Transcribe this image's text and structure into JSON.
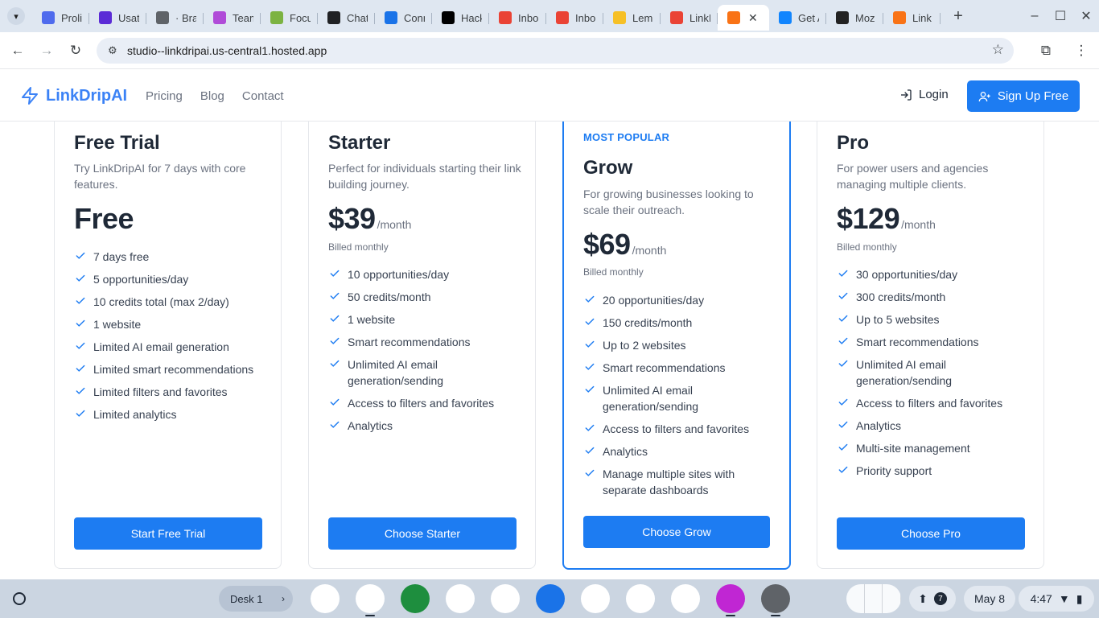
{
  "browser": {
    "tabs": [
      {
        "title": "Proli",
        "icon": "feather-icon",
        "color": "#4f6bed"
      },
      {
        "title": "Usat",
        "icon": "list-icon",
        "color": "#5b2bd6"
      },
      {
        "title": "· Bra",
        "icon": "globe-icon",
        "color": "#5f6368"
      },
      {
        "title": "Team",
        "icon": "magnifier-icon",
        "color": "#b04bd8"
      },
      {
        "title": "Focu",
        "icon": "doc-icon",
        "color": "#7cb342"
      },
      {
        "title": "Chat",
        "icon": "atom-icon",
        "color": "#202124"
      },
      {
        "title": "Conn",
        "icon": "link-icon",
        "color": "#1a73e8"
      },
      {
        "title": "Hack",
        "icon": "b-icon",
        "color": "#000000"
      },
      {
        "title": "Inbo",
        "icon": "gmail-icon",
        "color": "#ea4335"
      },
      {
        "title": "Inbo",
        "icon": "gmail-icon",
        "color": "#ea4335"
      },
      {
        "title": "Lem",
        "icon": "lemon-icon",
        "color": "#f6c026"
      },
      {
        "title": "LinkI",
        "icon": "bolt-icon",
        "color": "#ea4335"
      },
      {
        "title": "",
        "icon": "linkdrip-icon",
        "color": "#f97316",
        "active": true
      },
      {
        "title": "Get A",
        "icon": "butterfly-icon",
        "color": "#1185fe"
      },
      {
        "title": "Moz",
        "icon": "m-icon",
        "color": "#222222"
      },
      {
        "title": "Link",
        "icon": "nodes-icon",
        "color": "#f97316"
      }
    ],
    "url": "studio--linkdripai.us-central1.hosted.app"
  },
  "site": {
    "brand": "LinkDripAI",
    "nav": [
      "Pricing",
      "Blog",
      "Contact"
    ],
    "login": "Login",
    "signup": "Sign Up Free"
  },
  "plans": [
    {
      "name": "Free Trial",
      "description": "Try LinkDripAI for 7 days with core features.",
      "price": "Free",
      "period": "",
      "billing": "",
      "features": [
        "7 days free",
        "5 opportunities/day",
        "10 credits total (max 2/day)",
        "1 website",
        "Limited AI email generation",
        "Limited smart recommendations",
        "Limited filters and favorites",
        "Limited analytics"
      ],
      "cta": "Start Free Trial"
    },
    {
      "name": "Starter",
      "description": "Perfect for individuals starting their link building journey.",
      "price": "$39",
      "period": "/month",
      "billing": "Billed monthly",
      "features": [
        "10 opportunities/day",
        "50 credits/month",
        "1 website",
        "Smart recommendations",
        "Unlimited AI email generation/sending",
        "Access to filters and favorites",
        "Analytics"
      ],
      "cta": "Choose Starter"
    },
    {
      "name": "Grow",
      "badge": "MOST POPULAR",
      "description": "For growing businesses looking to scale their outreach.",
      "price": "$69",
      "period": "/month",
      "billing": "Billed monthly",
      "features": [
        "20 opportunities/day",
        "150 credits/month",
        "Up to 2 websites",
        "Smart recommendations",
        "Unlimited AI email generation/sending",
        "Access to filters and favorites",
        "Analytics",
        "Manage multiple sites with separate dashboards"
      ],
      "cta": "Choose Grow"
    },
    {
      "name": "Pro",
      "description": "For power users and agencies managing multiple clients.",
      "price": "$129",
      "period": "/month",
      "billing": "Billed monthly",
      "features": [
        "30 opportunities/day",
        "300 credits/month",
        "Up to 5 websites",
        "Smart recommendations",
        "Unlimited AI email generation/sending",
        "Access to filters and favorites",
        "Analytics",
        "Multi-site management",
        "Priority support"
      ],
      "cta": "Choose Pro"
    }
  ],
  "shelf": {
    "desk": "Desk 1",
    "apps": [
      {
        "name": "gemini-icon",
        "color": "#ffffff"
      },
      {
        "name": "chrome-icon",
        "color": "#ffffff"
      },
      {
        "name": "apps-icon",
        "color": "#1e8e3e"
      },
      {
        "name": "gmail-icon",
        "color": "#ffffff"
      },
      {
        "name": "calendar-icon",
        "color": "#ffffff"
      },
      {
        "name": "files-icon",
        "color": "#1a73e8"
      },
      {
        "name": "messages-icon",
        "color": "#ffffff"
      },
      {
        "name": "meet-icon",
        "color": "#ffffff"
      },
      {
        "name": "play-store-icon",
        "color": "#ffffff"
      },
      {
        "name": "app-icon",
        "color": "#c026d3"
      },
      {
        "name": "settings-icon",
        "color": "#5f6368"
      }
    ],
    "notification_count": "7",
    "date": "May 8",
    "time": "4:47"
  }
}
